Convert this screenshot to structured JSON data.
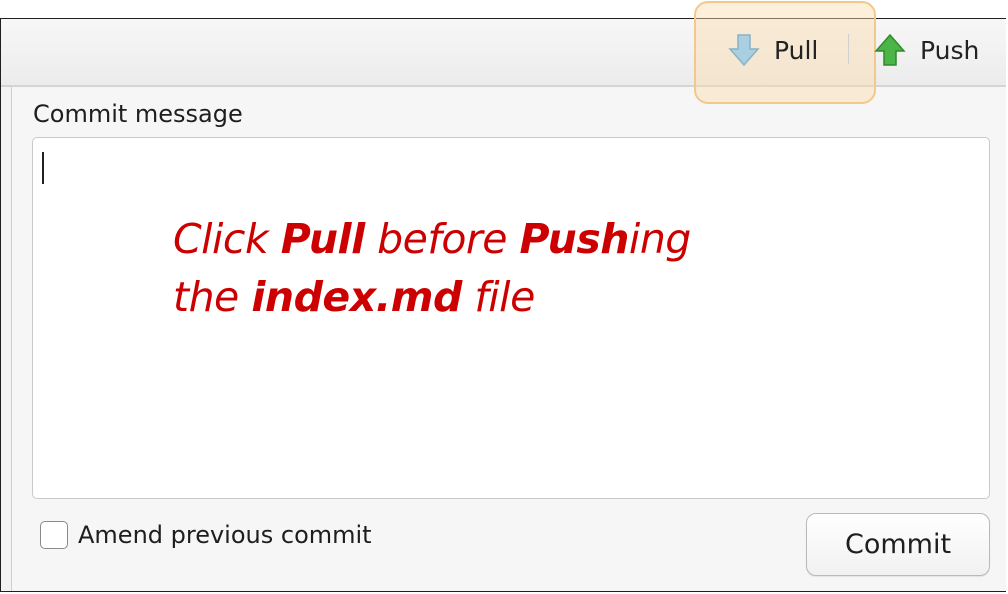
{
  "toolbar": {
    "pull_label": "Pull",
    "push_label": "Push",
    "pull_icon": "arrow-down-icon",
    "push_icon": "arrow-up-icon",
    "pull_icon_color": "#9ec4d6",
    "push_icon_color": "#3fa03a",
    "highlight_color": "#f0c98c"
  },
  "commit": {
    "message_label": "Commit message",
    "message_value": "",
    "amend_label": "Amend previous commit",
    "amend_checked": false,
    "commit_button_label": "Commit"
  },
  "annotation": {
    "color": "#cc0000",
    "line1": [
      {
        "text": "Click ",
        "bold": false
      },
      {
        "text": "Pull",
        "bold": true
      },
      {
        "text": " before ",
        "bold": false
      },
      {
        "text": "Push",
        "bold": true
      },
      {
        "text": "ing",
        "bold": false
      }
    ],
    "line2": [
      {
        "text": "the ",
        "bold": false
      },
      {
        "text": "index.md",
        "bold": true
      },
      {
        "text": " file",
        "bold": false
      }
    ]
  }
}
